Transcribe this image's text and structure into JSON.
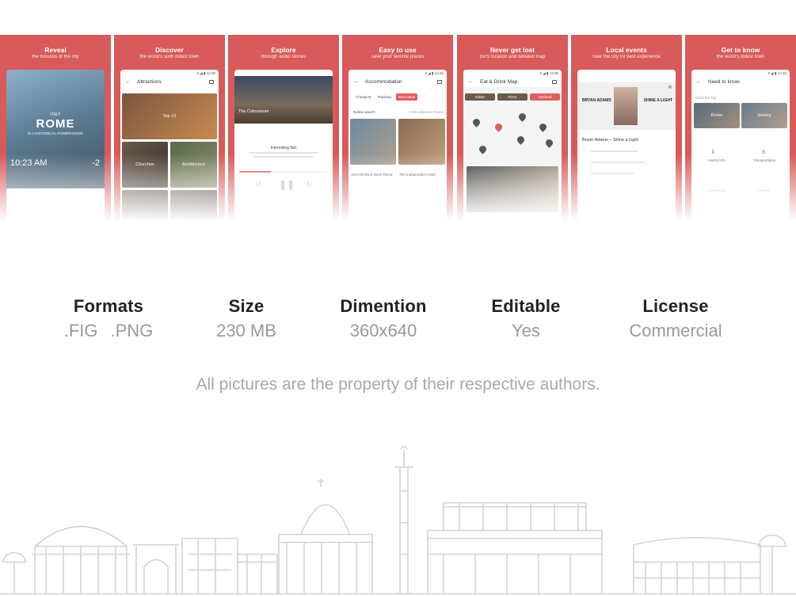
{
  "panels": [
    {
      "title": "Reveal",
      "subtitle": "the tresures of the city",
      "screen": {
        "city_label": "ITALY",
        "city_name": "ROME",
        "city_desc": "IS A HISTORICAL POWERHOUSE",
        "time": "10:23 AM",
        "temp": "-2"
      }
    },
    {
      "title": "Discover",
      "subtitle": "the world's sixth oldest town",
      "screen": {
        "appbar": "Attractions",
        "items": [
          "Top 10",
          "Churches",
          "Architecture"
        ]
      }
    },
    {
      "title": "Explore",
      "subtitle": "through audio stories",
      "screen": {
        "place": "The Colosseum",
        "fact_title": "Interesting fact"
      }
    },
    {
      "title": "Easy to use",
      "subtitle": "save your favorite places",
      "screen": {
        "appbar": "Accommodation",
        "filters": [
          "Cheapest",
          "Ranking",
          "Best Value"
        ],
        "refine": "Refine search",
        "results": "4,321 places in Rome",
        "hotel1": "UNAHOTELS Decò Roma",
        "hotel2": "The Independent Hotel"
      }
    },
    {
      "title": "Never get lost",
      "subtitle": "GPS location and detailed map",
      "screen": {
        "appbar": "Eat & Drink Map",
        "chips": [
          "Italian",
          "Pizza",
          "Seafood"
        ]
      }
    },
    {
      "title": "Local events",
      "subtitle": "near the city for best experience",
      "screen": {
        "poster_left": "BRYAN ADAMS",
        "poster_right": "SHINE A LIGHT",
        "event_title": "Bryan Adams – Shine a Light"
      }
    },
    {
      "title": "Get to know",
      "subtitle": "the world's oldest town",
      "screen": {
        "appbar": "Need to know",
        "section": "About the city",
        "tiles": [
          "Rome",
          "History"
        ],
        "items": [
          "Useful info",
          "Transportation",
          "Emergency",
          "Money"
        ]
      }
    }
  ],
  "info": [
    {
      "label": "Formats",
      "value_parts": [
        ".FIG",
        ".PNG"
      ]
    },
    {
      "label": "Size",
      "value": "230 MB"
    },
    {
      "label": "Dimention",
      "value": "360x640"
    },
    {
      "label": "Editable",
      "value": "Yes"
    },
    {
      "label": "License",
      "value": "Commercial"
    }
  ],
  "disclaimer": "All pictures are the property of their respective authors.",
  "colors": {
    "accent": "#d85a5a",
    "label": "#222222",
    "value": "#9a9a9a",
    "skyline": "#d4d4d4"
  }
}
